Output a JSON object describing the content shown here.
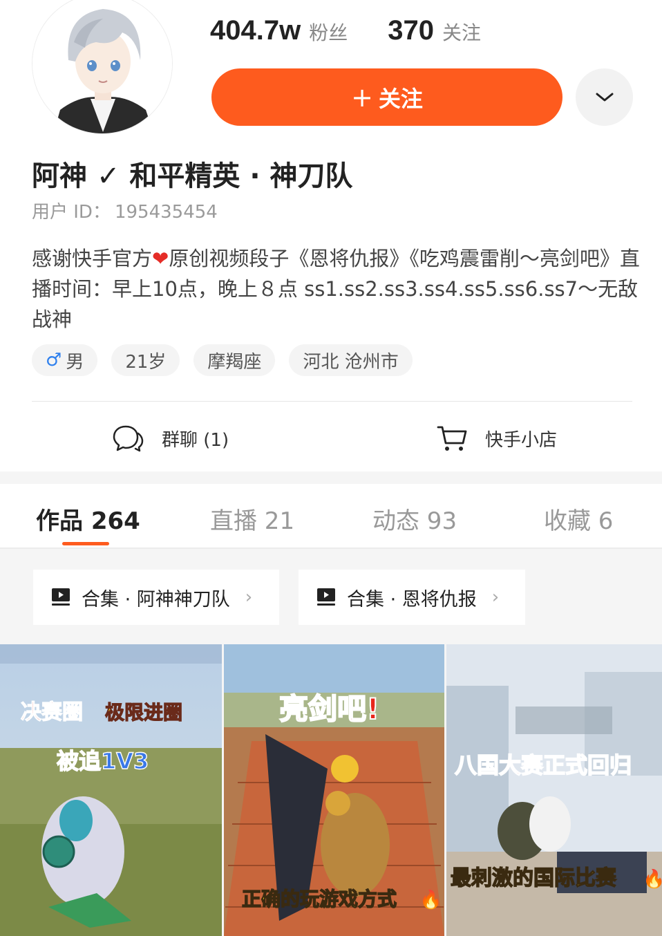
{
  "profile": {
    "fans_count": "404.7w",
    "fans_label": "粉丝",
    "following_count": "370",
    "following_label": "关注",
    "follow_button": "关注",
    "follow_plus": "+",
    "name": "阿神",
    "verified_mark": "✓",
    "team_name": "和平精英 · 神刀队",
    "user_id_label": "用户 ID：",
    "user_id": "195435454",
    "bio_part1": "感谢快手官方",
    "bio_heart": "❤",
    "bio_part2": "原创视频段子《恩将仇报》《吃鸡震雷削～亮剑吧》直播时间：早上10点，晚上８点 ss1.ss2.ss3.ss4.ss5.ss6.ss7～无敌战神",
    "tags": {
      "gender_symbol": "♂",
      "gender": "男",
      "age": "21岁",
      "zodiac": "摩羯座",
      "location": "河北 沧州市"
    },
    "group_chat_label": "群聊 (1)",
    "shop_label": "快手小店"
  },
  "tabs": [
    {
      "label": "作品 264"
    },
    {
      "label": "直播 21"
    },
    {
      "label": "动态 93"
    },
    {
      "label": "收藏 6"
    }
  ],
  "collections": [
    {
      "label": "合集 · 阿神神刀队",
      "chevron": "›"
    },
    {
      "label": "合集 · 恩将仇报",
      "chevron": "›"
    }
  ],
  "thumbnails": [
    {
      "caption_a": "决赛圈",
      "caption_b": "极限进圈",
      "caption_c": "被追1V3"
    },
    {
      "caption_top": "亮剑吧!",
      "caption_bottom": "正确的玩游戏方式"
    },
    {
      "caption_top": "八国大赛正式回归",
      "caption_bottom": "最刺激的国际比赛"
    }
  ],
  "colors": {
    "accent": "#fe5b1e",
    "text_primary": "#222222",
    "text_secondary": "#999999"
  },
  "icons": [
    "user-avatar",
    "chevron-down-icon",
    "verified-check-icon",
    "male-icon",
    "chat-bubble-icon",
    "shopping-cart-icon",
    "collection-play-icon",
    "fire-icon"
  ]
}
